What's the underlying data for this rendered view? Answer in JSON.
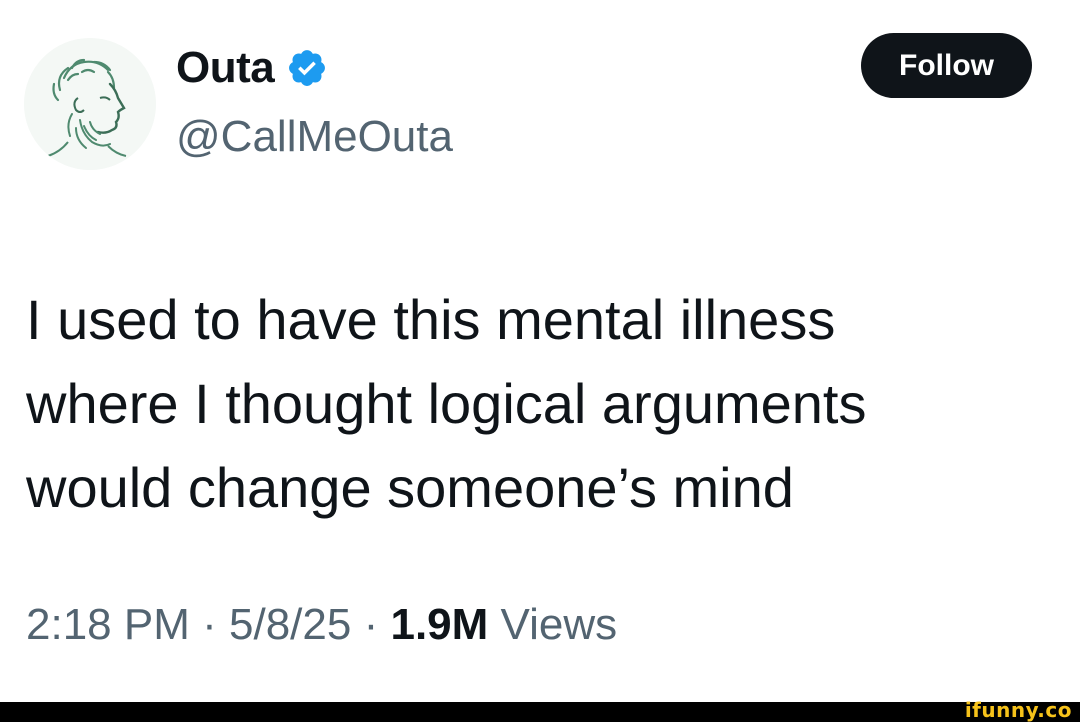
{
  "author": {
    "display_name": "Outa",
    "handle": "@CallMeOuta",
    "verified_icon": "verified-badge-icon",
    "avatar": "classical-bust-sketch"
  },
  "actions": {
    "follow_label": "Follow"
  },
  "tweet": {
    "lines": [
      "I used to have this mental illness",
      "where I thought logical arguments",
      "would change someone’s mind"
    ]
  },
  "meta": {
    "time": "2:18 PM",
    "separator": "·",
    "date": "5/8/25",
    "views_count": "1.9M",
    "views_label": "Views"
  },
  "watermark": "ifunny.co",
  "colors": {
    "text_primary": "#0f1419",
    "text_secondary": "#536471",
    "verified_blue": "#1d9bf0",
    "follow_bg": "#0f1419",
    "watermark": "#f6c21a"
  }
}
